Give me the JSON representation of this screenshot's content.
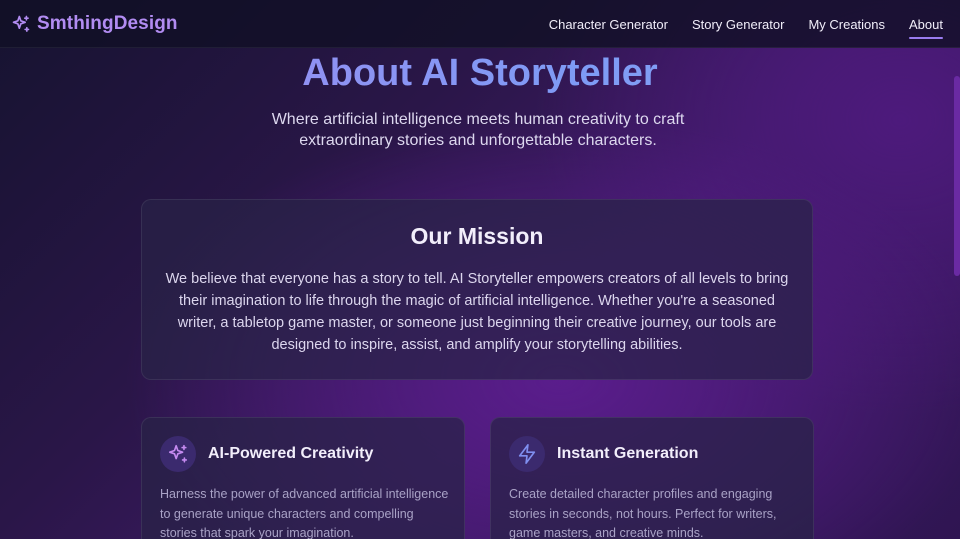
{
  "header": {
    "brand": "SmthingDesign",
    "brand_icon": "sparkles-icon",
    "nav": [
      {
        "label": "Character Generator",
        "active": false
      },
      {
        "label": "Story Generator",
        "active": false
      },
      {
        "label": "My Creations",
        "active": false
      },
      {
        "label": "About",
        "active": true
      }
    ]
  },
  "hero": {
    "title": "About AI Storyteller",
    "subtitle": "Where artificial intelligence meets human creativity to craft extraordinary stories and unforgettable characters."
  },
  "mission": {
    "title": "Our Mission",
    "text": "We believe that everyone has a story to tell. AI Storyteller empowers creators of all levels to bring their imagination to life through the magic of artificial intelligence. Whether you're a seasoned writer, a tabletop game master, or someone just beginning their creative journey, our tools are designed to inspire, assist, and amplify your storytelling abilities."
  },
  "features": [
    {
      "icon": "sparkles-icon",
      "title": "AI-Powered Creativity",
      "text": "Harness the power of advanced artificial intelligence to generate unique characters and compelling stories that spark your imagination."
    },
    {
      "icon": "lightning-icon",
      "title": "Instant Generation",
      "text": "Create detailed character profiles and engaging stories in seconds, not hours. Perfect for writers, game masters, and creative minds."
    }
  ],
  "colors": {
    "accent": "#9a7cf0",
    "brand": "#b28cf2",
    "title_gradient_start": "#a487f0",
    "title_gradient_end": "#8aa5f6"
  }
}
